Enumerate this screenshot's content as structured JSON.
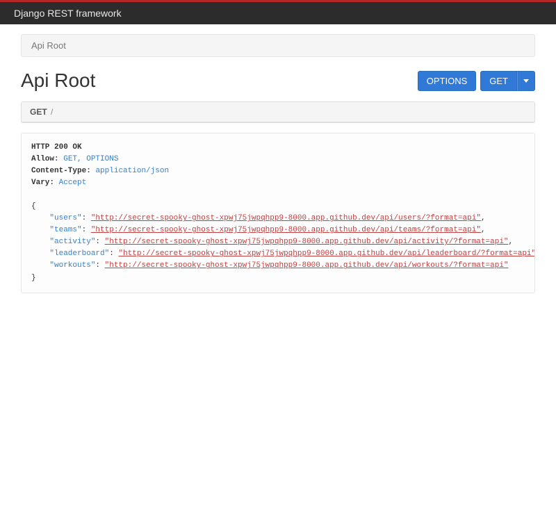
{
  "brand": "Django REST framework",
  "breadcrumb": "Api Root",
  "title": "Api Root",
  "buttons": {
    "options": "OPTIONS",
    "get": "GET"
  },
  "request": {
    "method": "GET",
    "path": "/"
  },
  "response": {
    "status": "HTTP 200 OK",
    "allow_label": "Allow:",
    "allow_value": "GET, OPTIONS",
    "content_type_label": "Content-Type:",
    "content_type_value": "application/json",
    "vary_label": "Vary:",
    "vary_value": "Accept",
    "body": {
      "users_key": "\"users\"",
      "users_val": "\"http://secret-spooky-ghost-xpwj75jwpqhpp9-8000.app.github.dev/api/users/?format=api\"",
      "teams_key": "\"teams\"",
      "teams_val": "\"http://secret-spooky-ghost-xpwj75jwpqhpp9-8000.app.github.dev/api/teams/?format=api\"",
      "activity_key": "\"activity\"",
      "activity_val": "\"http://secret-spooky-ghost-xpwj75jwpqhpp9-8000.app.github.dev/api/activity/?format=api\"",
      "leaderboard_key": "\"leaderboard\"",
      "leaderboard_val": "\"http://secret-spooky-ghost-xpwj75jwpqhpp9-8000.app.github.dev/api/leaderboard/?format=api\"",
      "workouts_key": "\"workouts\"",
      "workouts_val": "\"http://secret-spooky-ghost-xpwj75jwpqhpp9-8000.app.github.dev/api/workouts/?format=api\""
    }
  }
}
